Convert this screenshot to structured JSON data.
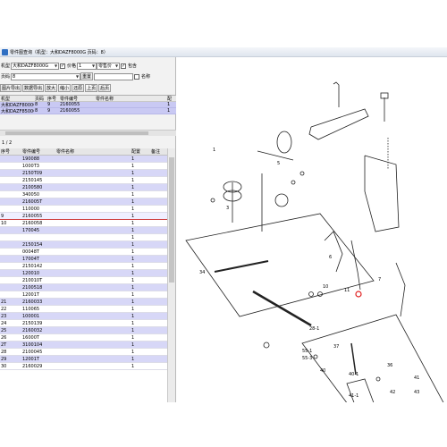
{
  "title": "零件图查询（机型：大和DAZF8000G 页码：8）",
  "toolbar": {
    "model_label": "机型",
    "model_value": "大和DAZF8000G",
    "price_label": "价格",
    "price_value": "1",
    "price_kind": "零售价",
    "include_label": "包含",
    "page_label": "页码",
    "page_value": "8",
    "reset_label": "重置",
    "name_label": "名称",
    "btn_export_images": "图片导出",
    "btn_export_data": "数据导出",
    "btn_zoom_in": "放大",
    "btn_zoom_out": "缩小",
    "btn_restore": "还原",
    "btn_prev": "上页",
    "btn_next": "后页"
  },
  "top_grid": {
    "headers": [
      "机型",
      "页码",
      "序号",
      "零件编号",
      "零件名称",
      "配"
    ],
    "rows": [
      [
        "大和DAZF8000G",
        "8",
        "9",
        "2160055",
        "",
        "1"
      ],
      [
        "大和DAZF8500G",
        "8",
        "9",
        "2160055",
        "",
        "1"
      ]
    ]
  },
  "pager": "1 / 2",
  "parts_grid": {
    "headers": [
      "序号",
      "零件编号",
      "零件名称",
      "配置",
      "备注"
    ],
    "rows": [
      [
        "",
        "190088",
        "",
        "1",
        ""
      ],
      [
        "",
        "1000T3",
        "",
        "1",
        ""
      ],
      [
        "",
        "2150T09",
        "",
        "1",
        ""
      ],
      [
        "",
        "2150145",
        "",
        "1",
        ""
      ],
      [
        "",
        "2100580",
        "",
        "1",
        ""
      ],
      [
        "",
        "340050",
        "",
        "1",
        ""
      ],
      [
        "",
        "216005T",
        "",
        "1",
        ""
      ],
      [
        "",
        "110000",
        "",
        "1",
        ""
      ],
      [
        "9",
        "2160055",
        "",
        "1",
        ""
      ],
      [
        "10",
        "2160058",
        "",
        "1",
        ""
      ],
      [
        "",
        "170045",
        "",
        "1",
        ""
      ],
      [
        "",
        "",
        "",
        "1",
        ""
      ],
      [
        "",
        "2150154",
        "",
        "1",
        ""
      ],
      [
        "",
        "00048T",
        "",
        "1",
        ""
      ],
      [
        "",
        "17004T",
        "",
        "1",
        ""
      ],
      [
        "",
        "2150142",
        "",
        "1",
        ""
      ],
      [
        "",
        "120010",
        "",
        "1",
        ""
      ],
      [
        "",
        "210010T",
        "",
        "1",
        ""
      ],
      [
        "",
        "2100518",
        "",
        "1",
        ""
      ],
      [
        "",
        "12001T",
        "",
        "1",
        ""
      ],
      [
        "21",
        "2160033",
        "",
        "1",
        ""
      ],
      [
        "22",
        "110065",
        "",
        "1",
        ""
      ],
      [
        "23",
        "100001",
        "",
        "1",
        ""
      ],
      [
        "24",
        "2150139",
        "",
        "1",
        ""
      ],
      [
        "25",
        "2160032",
        "",
        "1",
        ""
      ],
      [
        "26",
        "16000T",
        "",
        "1",
        ""
      ],
      [
        "2T",
        "3100104",
        "",
        "1",
        ""
      ],
      [
        "28",
        "2100045",
        "",
        "1",
        ""
      ],
      [
        "29",
        "12001T",
        "",
        "1",
        ""
      ],
      [
        "30",
        "2160029",
        "",
        "1",
        ""
      ]
    ]
  },
  "diagram_labels": [
    "1",
    "3",
    "5",
    "6",
    "7",
    "10",
    "11",
    "34",
    "36",
    "37",
    "40",
    "41",
    "42",
    "43",
    "40-1",
    "41-1",
    "55-1",
    "55-3",
    "28-1"
  ]
}
